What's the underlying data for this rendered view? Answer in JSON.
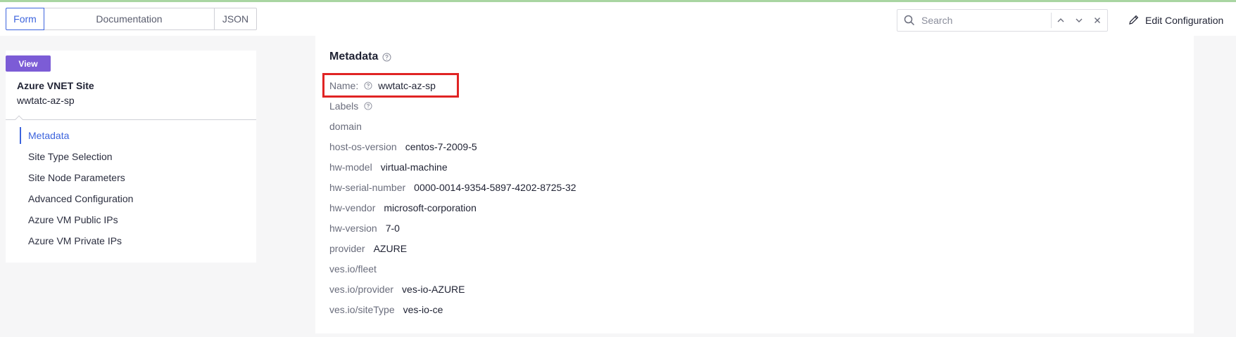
{
  "tabs": [
    {
      "label": "Form",
      "active": true
    },
    {
      "label": "Documentation",
      "active": false
    },
    {
      "label": "JSON",
      "active": false
    }
  ],
  "search": {
    "placeholder": "Search",
    "value": ""
  },
  "toolbar": {
    "edit_label": "Edit Configuration"
  },
  "sidebar": {
    "badge": "View",
    "site_type": "Azure VNET Site",
    "site_name": "wwtatc-az-sp",
    "items": [
      {
        "label": "Metadata",
        "active": true
      },
      {
        "label": "Site Type Selection",
        "active": false
      },
      {
        "label": "Site Node Parameters",
        "active": false
      },
      {
        "label": "Advanced Configuration",
        "active": false
      },
      {
        "label": "Azure VM Public IPs",
        "active": false
      },
      {
        "label": "Azure VM Private IPs",
        "active": false
      }
    ]
  },
  "main": {
    "title": "Metadata",
    "name_label": "Name:",
    "name_value": "wwtatc-az-sp",
    "labels_label": "Labels",
    "labels": [
      {
        "key": "domain",
        "value": ""
      },
      {
        "key": "host-os-version",
        "value": "centos-7-2009-5"
      },
      {
        "key": "hw-model",
        "value": "virtual-machine"
      },
      {
        "key": "hw-serial-number",
        "value": "0000-0014-9354-5897-4202-8725-32"
      },
      {
        "key": "hw-vendor",
        "value": "microsoft-corporation"
      },
      {
        "key": "hw-version",
        "value": "7-0"
      },
      {
        "key": "provider",
        "value": "AZURE"
      },
      {
        "key": "ves.io/fleet",
        "value": ""
      },
      {
        "key": "ves.io/provider",
        "value": "ves-io-AZURE"
      },
      {
        "key": "ves.io/siteType",
        "value": "ves-io-ce"
      }
    ]
  },
  "colors": {
    "accent": "#3d64dd",
    "badge": "#7c5cd6",
    "highlight": "#e02424"
  }
}
